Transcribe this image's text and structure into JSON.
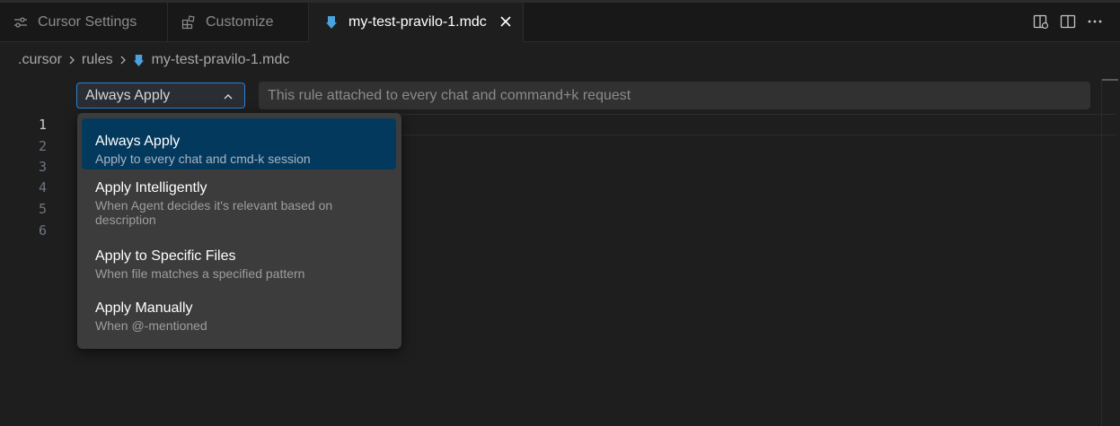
{
  "tabs": [
    {
      "label": "Cursor Settings",
      "icon": "settings-sliders-icon"
    },
    {
      "label": "Customize",
      "icon": "extensions-icon"
    },
    {
      "label": "my-test-pravilo-1.mdc",
      "icon": "cursor-rule-file-icon",
      "active": true
    }
  ],
  "tabbar_actions": [
    "split-editor-right-icon",
    "split-editor-icon",
    "more-actions-icon"
  ],
  "breadcrumb": {
    "items": [
      ".cursor",
      "rules",
      "my-test-pravilo-1.mdc"
    ]
  },
  "rule_type": {
    "selected": "Always Apply",
    "options": [
      {
        "label": "Always Apply",
        "description": "Apply to every chat and cmd-k session"
      },
      {
        "label": "Apply Intelligently",
        "description": "When Agent decides it's relevant based on description"
      },
      {
        "label": "Apply to Specific Files",
        "description": "When file matches a specified pattern"
      },
      {
        "label": "Apply Manually",
        "description": "When @-mentioned"
      }
    ]
  },
  "description_input": {
    "value": "",
    "placeholder": "This rule attached to every chat and command+k request"
  },
  "editor": {
    "line_numbers": [
      "1",
      "2",
      "3",
      "4",
      "5",
      "6"
    ],
    "active_line": "1"
  },
  "colors": {
    "accent": "#2f7fd1",
    "selected_option": "#04395e",
    "file_icon": "#4aa3df",
    "background": "#1e1e1e"
  }
}
